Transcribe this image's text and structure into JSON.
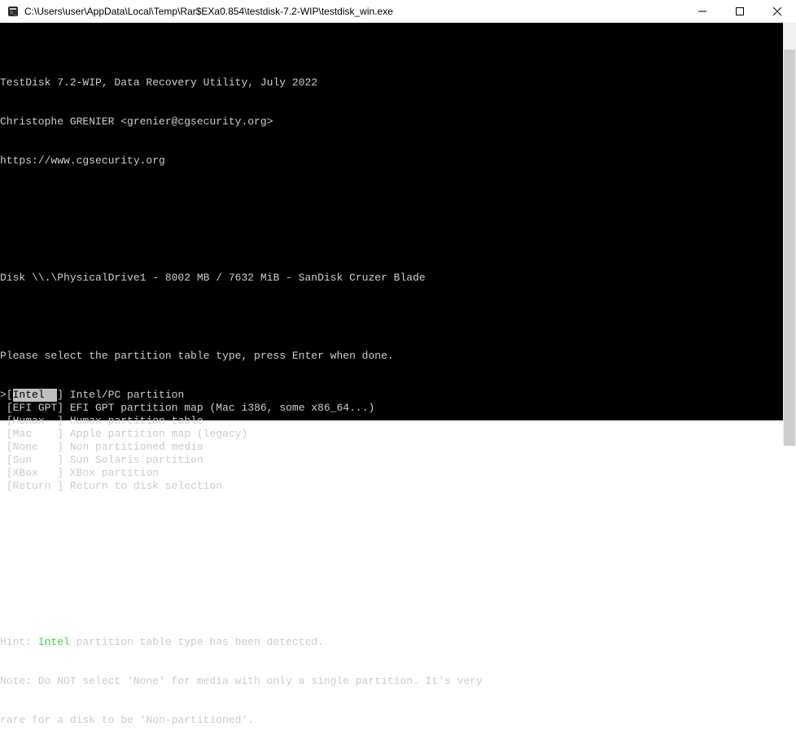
{
  "window": {
    "title": "C:\\Users\\user\\AppData\\Local\\Temp\\Rar$EXa0.854\\testdisk-7.2-WIP\\testdisk_win.exe"
  },
  "header": {
    "line1": "TestDisk 7.2-WIP, Data Recovery Utility, July 2022",
    "line2": "Christophe GRENIER <grenier@cgsecurity.org>",
    "line3": "https://www.cgsecurity.org"
  },
  "disk": "Disk \\\\.\\PhysicalDrive1 - 8002 MB / 7632 MiB - SanDisk Cruzer Blade",
  "prompt": "Please select the partition table type, press Enter when done.",
  "selected_marker": ">",
  "menu": [
    {
      "key": "Intel  ",
      "desc": "Intel/PC partition",
      "selected": true
    },
    {
      "key": "EFI GPT",
      "desc": "EFI GPT partition map (Mac i386, some x86_64...)",
      "selected": false
    },
    {
      "key": "Humax  ",
      "desc": "Humax partition table",
      "selected": false
    },
    {
      "key": "Mac    ",
      "desc": "Apple partition map (legacy)",
      "selected": false
    },
    {
      "key": "None   ",
      "desc": "Non partitioned media",
      "selected": false
    },
    {
      "key": "Sun    ",
      "desc": "Sun Solaris partition",
      "selected": false
    },
    {
      "key": "XBox   ",
      "desc": "XBox partition",
      "selected": false
    },
    {
      "key": "Return ",
      "desc": "Return to disk selection",
      "selected": false
    }
  ],
  "hint": {
    "prefix": "Hint: ",
    "highlight": "Intel",
    "suffix": " partition table type has been detected."
  },
  "note1": "Note: Do NOT select 'None' for media with only a single partition. It's very",
  "note2": "rare for a disk to be 'Non-partitioned'."
}
